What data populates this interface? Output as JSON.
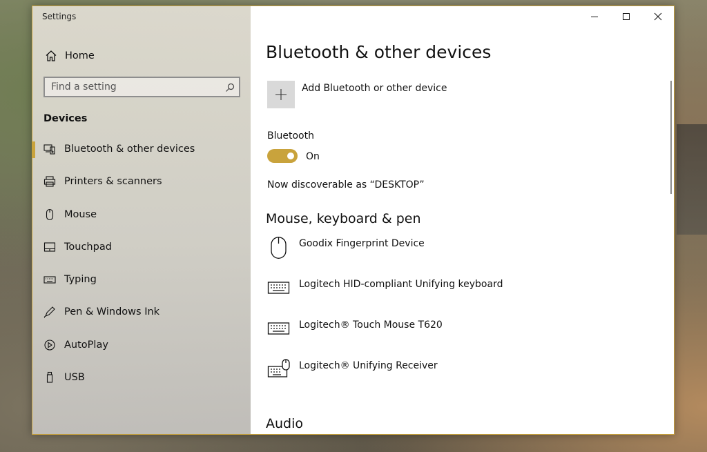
{
  "window": {
    "title": "Settings",
    "accent_color": "#c9a33c"
  },
  "sidebar": {
    "home_label": "Home",
    "search_placeholder": "Find a setting",
    "section_label": "Devices",
    "items": [
      {
        "label": "Bluetooth & other devices",
        "icon": "bluetooth-devices-icon",
        "active": true
      },
      {
        "label": "Printers & scanners",
        "icon": "printer-icon"
      },
      {
        "label": "Mouse",
        "icon": "mouse-icon"
      },
      {
        "label": "Touchpad",
        "icon": "touchpad-icon"
      },
      {
        "label": "Typing",
        "icon": "keyboard-icon"
      },
      {
        "label": "Pen & Windows Ink",
        "icon": "pen-icon"
      },
      {
        "label": "AutoPlay",
        "icon": "autoplay-icon"
      },
      {
        "label": "USB",
        "icon": "usb-icon"
      }
    ]
  },
  "main": {
    "title": "Bluetooth & other devices",
    "add_device_label": "Add Bluetooth or other device",
    "bluetooth_label": "Bluetooth",
    "bluetooth_state": "On",
    "discoverable_text": "Now discoverable as “DESKTOP”",
    "mouse_section_title": "Mouse, keyboard & pen",
    "devices": [
      {
        "label": "Goodix Fingerprint Device",
        "icon": "mouse-icon"
      },
      {
        "label": "Logitech HID-compliant Unifying keyboard",
        "icon": "keyboard-icon"
      },
      {
        "label": "Logitech® Touch Mouse T620",
        "icon": "keyboard-icon"
      },
      {
        "label": "Logitech® Unifying Receiver",
        "icon": "keyboard-mouse-icon"
      }
    ],
    "audio_section_title": "Audio"
  }
}
